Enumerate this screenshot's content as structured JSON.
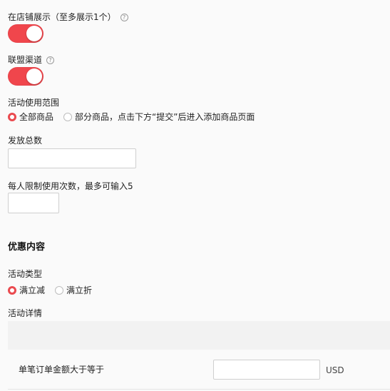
{
  "store_display": {
    "label": "在店铺展示（至多展示1个）",
    "enabled": true
  },
  "alliance_channel": {
    "label": "联盟渠道",
    "enabled": true
  },
  "help_icon": "question-circle-icon",
  "scope": {
    "label": "活动使用范围",
    "options": [
      {
        "label": "全部商品",
        "selected": true
      },
      {
        "label": "部分商品，点击下方“提交”后进入添加商品页面",
        "selected": false
      }
    ]
  },
  "total_issue": {
    "label": "发放总数",
    "value": ""
  },
  "per_person_limit": {
    "label": "每人限制使用次数，最多可输入5",
    "value": ""
  },
  "discount_section": {
    "title": "优惠内容"
  },
  "activity_type": {
    "label": "活动类型",
    "options": [
      {
        "label": "满立减",
        "selected": true
      },
      {
        "label": "满立折",
        "selected": false
      }
    ]
  },
  "activity_details": {
    "label": "活动详情"
  },
  "min_order": {
    "label": "单笔订单金额大于等于",
    "value": "",
    "unit": "USD"
  },
  "colors": {
    "accent": "#f0464c",
    "radio": "#ea4a4f"
  }
}
